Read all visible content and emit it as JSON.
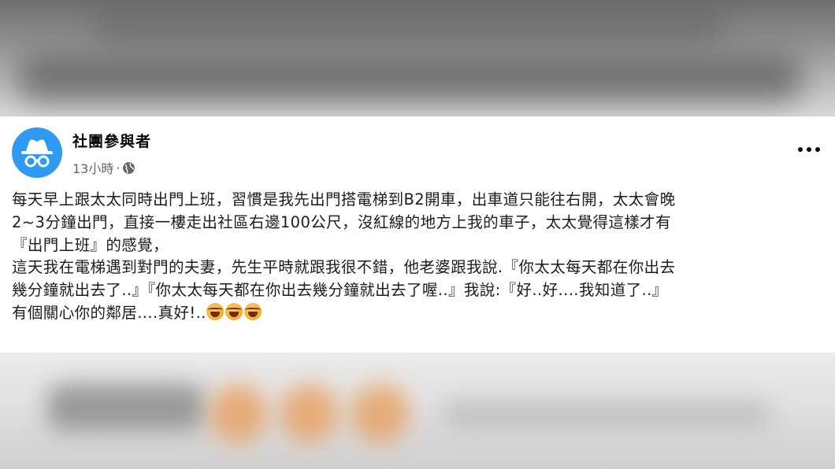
{
  "post": {
    "author_name": "社團參與者",
    "time": "13小時",
    "separator": "·",
    "privacy_icon": "globe-icon",
    "more_icon": "more-options-icon",
    "body_lines": [
      "每天早上跟太太同時出門上班，習慣是我先出門搭電梯到B2開車，出車道只能往右開，太太會晚",
      "2~3分鐘出門，直接一樓走出社區右邊100公尺，沒紅線的地方上我的車子，太太覺得這樣才有",
      "『出門上班』的感覺，",
      "這天我在電梯遇到對門的夫妻，先生平時就跟我很不錯，他老婆跟我說.『你太太每天都在你出去",
      "幾分鐘就出去了..』『你太太每天都在你出去幾分鐘就出去了喔..』我說:『好..好....我知道了..』",
      "有個關心你的鄰居....真好!.."
    ],
    "emoji_name": "rolling-on-floor-laughing-emoji",
    "emoji_count": 3
  },
  "colors": {
    "avatar_bg": "#2e9af1",
    "name_text": "#050505",
    "meta_text": "#65676b",
    "body_text": "#1c1c1c"
  }
}
